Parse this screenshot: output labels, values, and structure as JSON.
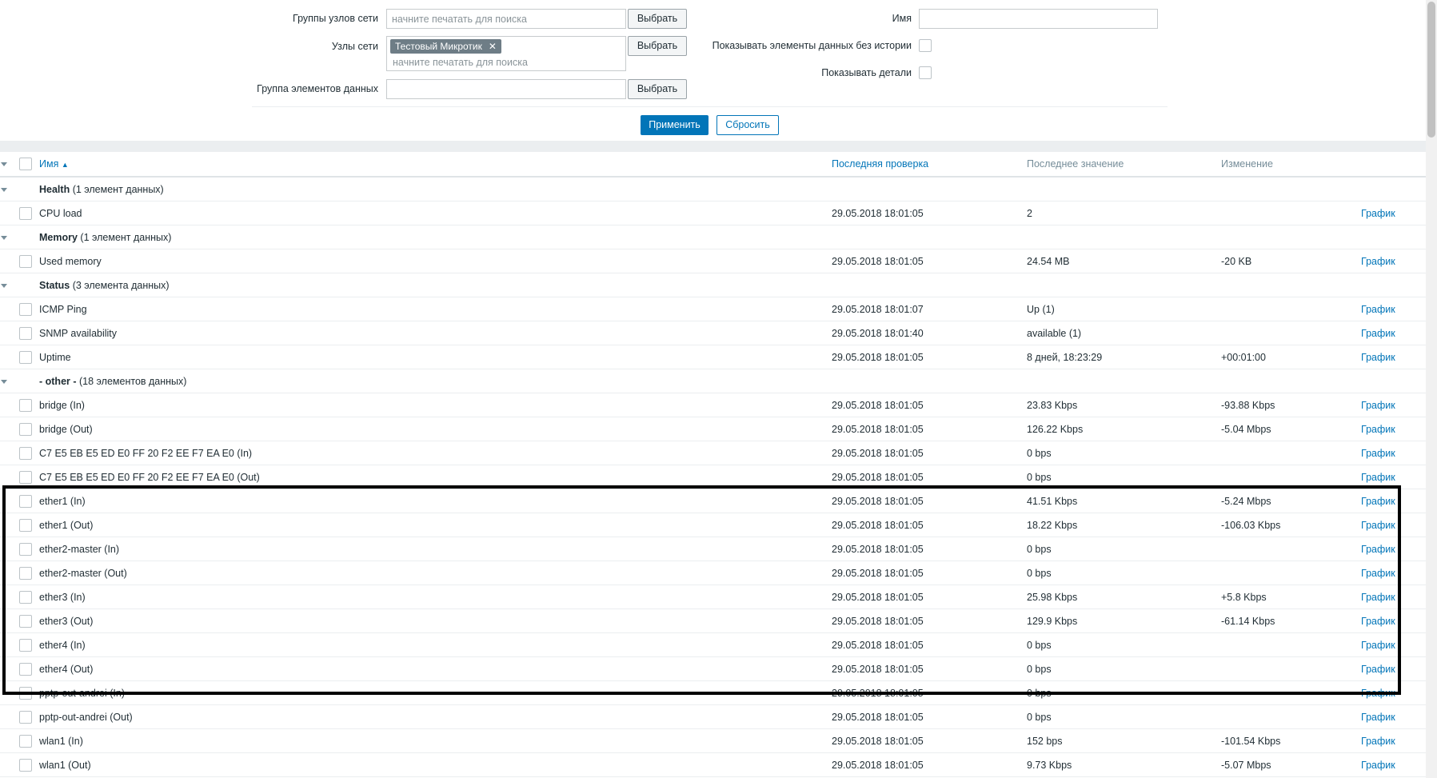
{
  "filter": {
    "host_groups": {
      "label": "Группы узлов сети",
      "placeholder": "начните печатать для поиска",
      "button": "Выбрать"
    },
    "hosts": {
      "label": "Узлы сети",
      "tag": "Тестовый Микротик",
      "tag_remove": "✕",
      "placeholder": "начните печатать для поиска",
      "button": "Выбрать"
    },
    "app": {
      "label": "Группа элементов данных",
      "value": "",
      "button": "Выбрать"
    },
    "name": {
      "label": "Имя",
      "value": ""
    },
    "show_without_data": {
      "label": "Показывать элементы данных без истории",
      "checked": false
    },
    "show_details": {
      "label": "Показывать детали",
      "checked": false
    },
    "apply_button": "Применить",
    "reset_button": "Сбросить"
  },
  "table": {
    "headers": {
      "name": "Имя",
      "sort_arrow": "▲",
      "last_check": "Последняя проверка",
      "last_value": "Последнее значение",
      "change": "Изменение"
    },
    "rows": [
      {
        "type": "group",
        "name": "Health",
        "count": "(1 элемент данных)"
      },
      {
        "type": "item",
        "name": "CPU load",
        "last_check": "29.05.2018 18:01:05",
        "last_value": "2",
        "change": "",
        "action": "График"
      },
      {
        "type": "group",
        "name": "Memory",
        "count": "(1 элемент данных)"
      },
      {
        "type": "item",
        "name": "Used memory",
        "last_check": "29.05.2018 18:01:05",
        "last_value": "24.54 MB",
        "change": "-20 KB",
        "action": "График"
      },
      {
        "type": "group",
        "name": "Status",
        "count": "(3 элемента данных)"
      },
      {
        "type": "item",
        "name": "ICMP Ping",
        "last_check": "29.05.2018 18:01:07",
        "last_value": "Up (1)",
        "change": "",
        "action": "График"
      },
      {
        "type": "item",
        "name": "SNMP availability",
        "last_check": "29.05.2018 18:01:40",
        "last_value": "available (1)",
        "change": "",
        "action": "График"
      },
      {
        "type": "item",
        "name": "Uptime",
        "last_check": "29.05.2018 18:01:05",
        "last_value": "8 дней, 18:23:29",
        "change": "+00:01:00",
        "action": "График"
      },
      {
        "type": "group",
        "name": "- other -",
        "count": "(18 элементов данных)"
      },
      {
        "type": "item",
        "name": "bridge (In)",
        "last_check": "29.05.2018 18:01:05",
        "last_value": "23.83 Kbps",
        "change": "-93.88 Kbps",
        "action": "График"
      },
      {
        "type": "item",
        "name": "bridge (Out)",
        "last_check": "29.05.2018 18:01:05",
        "last_value": "126.22 Kbps",
        "change": "-5.04 Mbps",
        "action": "График"
      },
      {
        "type": "item",
        "name": "C7 E5 EB E5 ED E0 FF 20 F2 EE F7 EA E0 (In)",
        "last_check": "29.05.2018 18:01:05",
        "last_value": "0 bps",
        "change": "",
        "action": "График"
      },
      {
        "type": "item",
        "name": "C7 E5 EB E5 ED E0 FF 20 F2 EE F7 EA E0 (Out)",
        "last_check": "29.05.2018 18:01:05",
        "last_value": "0 bps",
        "change": "",
        "action": "График"
      },
      {
        "type": "item",
        "name": "ether1 (In)",
        "last_check": "29.05.2018 18:01:05",
        "last_value": "41.51 Kbps",
        "change": "-5.24 Mbps",
        "action": "График"
      },
      {
        "type": "item",
        "name": "ether1 (Out)",
        "last_check": "29.05.2018 18:01:05",
        "last_value": "18.22 Kbps",
        "change": "-106.03 Kbps",
        "action": "График"
      },
      {
        "type": "item",
        "name": "ether2-master (In)",
        "last_check": "29.05.2018 18:01:05",
        "last_value": "0 bps",
        "change": "",
        "action": "График"
      },
      {
        "type": "item",
        "name": "ether2-master (Out)",
        "last_check": "29.05.2018 18:01:05",
        "last_value": "0 bps",
        "change": "",
        "action": "График"
      },
      {
        "type": "item",
        "name": "ether3 (In)",
        "last_check": "29.05.2018 18:01:05",
        "last_value": "25.98 Kbps",
        "change": "+5.8 Kbps",
        "action": "График"
      },
      {
        "type": "item",
        "name": "ether3 (Out)",
        "last_check": "29.05.2018 18:01:05",
        "last_value": "129.9 Kbps",
        "change": "-61.14 Kbps",
        "action": "График"
      },
      {
        "type": "item",
        "name": "ether4 (In)",
        "last_check": "29.05.2018 18:01:05",
        "last_value": "0 bps",
        "change": "",
        "action": "График"
      },
      {
        "type": "item",
        "name": "ether4 (Out)",
        "last_check": "29.05.2018 18:01:05",
        "last_value": "0 bps",
        "change": "",
        "action": "График"
      },
      {
        "type": "item",
        "name": "pptp-out-andrei (In)",
        "last_check": "29.05.2018 18:01:05",
        "last_value": "0 bps",
        "change": "",
        "action": "График"
      },
      {
        "type": "item",
        "name": "pptp-out-andrei (Out)",
        "last_check": "29.05.2018 18:01:05",
        "last_value": "0 bps",
        "change": "",
        "action": "График"
      },
      {
        "type": "item",
        "name": "wlan1 (In)",
        "last_check": "29.05.2018 18:01:05",
        "last_value": "152 bps",
        "change": "-101.54 Kbps",
        "action": "График"
      },
      {
        "type": "item",
        "name": "wlan1 (Out)",
        "last_check": "29.05.2018 18:01:05",
        "last_value": "9.73 Kbps",
        "change": "-5.07 Mbps",
        "action": "График"
      }
    ]
  },
  "colors": {
    "accent": "#0275b8",
    "text": "#1f2c33",
    "muted": "#768d99",
    "highlight_box": "#000000"
  }
}
